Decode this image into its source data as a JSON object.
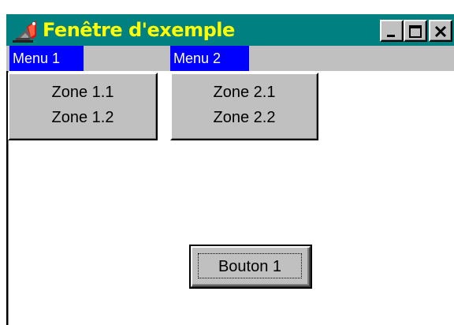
{
  "window": {
    "title": "Fenêtre d'exemple",
    "icon": "app-icon",
    "controls": [
      "minimize-icon",
      "maximize-icon",
      "close-icon"
    ]
  },
  "menubar": {
    "items": [
      {
        "label": "Menu 1",
        "submenu": [
          "Zone 1.1",
          "Zone 1.2"
        ]
      },
      {
        "label": "Menu 2",
        "submenu": [
          "Zone 2.1",
          "Zone 2.2"
        ]
      }
    ]
  },
  "button": {
    "label": "Bouton  1"
  },
  "colors": {
    "titlebar": "#008080",
    "title_text": "#ffff00",
    "menu_highlight": "#0000ff",
    "face": "#c0c0c0"
  }
}
